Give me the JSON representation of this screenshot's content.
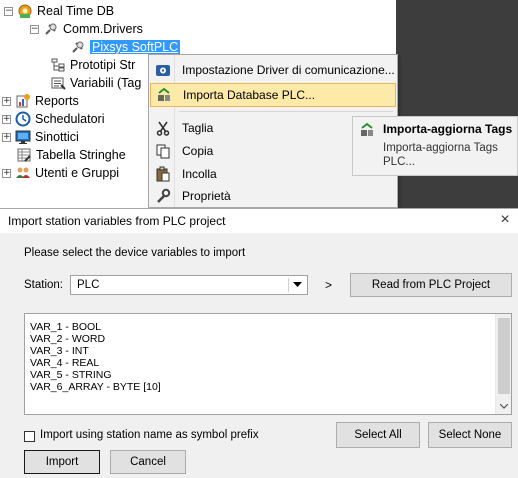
{
  "tree": {
    "root": "Real Time DB",
    "comm_drivers": "Comm.Drivers",
    "selected_item": "Pixsys SoftPLC",
    "prototipi": "Prototipi Str",
    "variabili": "Variabili (Tag",
    "reports": "Reports",
    "schedulatori": "Schedulatori",
    "sinottici": "Sinottici",
    "tabella": "Tabella Stringhe",
    "utenti": "Utenti e Gruppi"
  },
  "context_menu": {
    "items": [
      {
        "label": "Impostazione Driver di comunicazione...",
        "icon": "driver-settings-icon"
      },
      {
        "label": "Importa Database PLC...",
        "icon": "import-database-icon"
      },
      {
        "label": "Taglia",
        "icon": "scissors-icon"
      },
      {
        "label": "Copia",
        "icon": "copy-icon"
      },
      {
        "label": "Incolla",
        "icon": "paste-icon"
      },
      {
        "label": "Proprietà",
        "icon": "wrench-icon"
      }
    ]
  },
  "submenu": {
    "title": "Importa-aggiorna Tags",
    "description": "Importa-aggiorna Tags PLC..."
  },
  "dialog": {
    "title": "Import station variables from PLC project",
    "close": "×",
    "instruction": "Please select the device variables to import",
    "station_label": "Station:",
    "station_value": "PLC",
    "arrow": ">",
    "read_button": "Read from PLC Project",
    "variables": [
      "VAR_1 - BOOL",
      "VAR_2 - WORD",
      "VAR_3 - INT",
      "VAR_4 - REAL",
      "VAR_5 - STRING",
      "VAR_6_ARRAY - BYTE [10]"
    ],
    "prefix_checkbox_label": "Import using station name as symbol prefix",
    "prefix_checked": false,
    "select_all": "Select All",
    "select_none": "Select None",
    "import_button": "Import",
    "cancel_button": "Cancel"
  },
  "colors": {
    "selection": "#3399ff",
    "menu_highlight": "#fde9a8",
    "dark_panel": "#3d3d3d"
  }
}
